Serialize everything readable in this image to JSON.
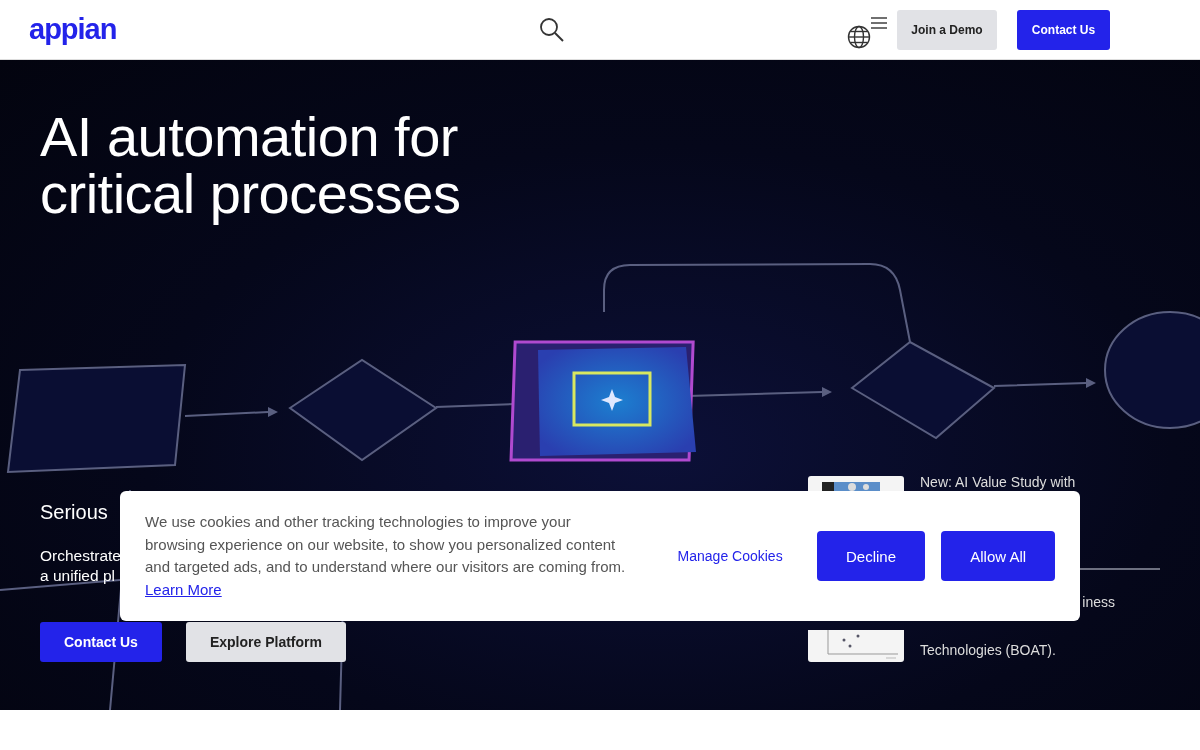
{
  "header": {
    "logo": "appian",
    "buttons": [
      {
        "label": "Join a Demo",
        "kind": "secondary"
      },
      {
        "label": "Contact Us",
        "kind": "primary"
      }
    ]
  },
  "hero": {
    "title_lines": [
      "AI automation for",
      "critical processes"
    ],
    "subtitle": "Serious",
    "description_lines": [
      "Orchestrate",
      "a unified pl"
    ],
    "buttons": [
      {
        "label": "Contact Us",
        "kind": "primary"
      },
      {
        "label": "Explore Platform",
        "kind": "secondary"
      }
    ],
    "news": [
      {
        "lines": [
          {
            "text": "New: AI Value Study with",
            "covered": false
          }
        ]
      },
      {
        "lines": [
          {
            "text": "iness",
            "covered": true
          },
          {
            "text": "Technologies (BOAT).",
            "covered": false
          }
        ]
      }
    ]
  },
  "cookie_banner": {
    "text": "We use cookies and other tracking technologies to improve your browsing experience on our website, to show you personalized content and targeted ads, and to understand where our visitors are coming from.",
    "link": "Learn More",
    "manage": "Manage Cookies",
    "buttons": [
      "Decline",
      "Allow All"
    ]
  }
}
